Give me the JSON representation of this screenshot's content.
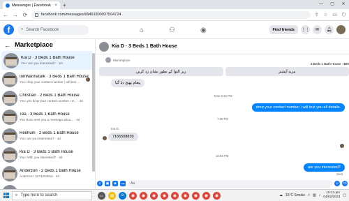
{
  "browser": {
    "tab_title": "Messenger | Facebook",
    "tab_close": "×",
    "new_tab": "+",
    "url": "facebook.com/messages/t/9491800937504724",
    "window_controls": [
      "—",
      "▢",
      "✕"
    ],
    "nav": {
      "back": "←",
      "forward": "→",
      "reload": "⟳"
    },
    "extensions": [
      "⇪",
      "☆",
      "▭",
      "⬡"
    ]
  },
  "fb_header": {
    "logo": "f",
    "search_placeholder": "Search Facebook",
    "find_friends": "Find friends",
    "nav_icons": [
      "home-icon",
      "groups-icon",
      "gaming-icon"
    ],
    "nav_glyphs": [
      "⌂",
      "⚇",
      "◉"
    ]
  },
  "sidebar": {
    "title": "Marketplace",
    "back_glyph": "←",
    "conversations": [
      {
        "name": "Kia D · 3 Beds 1 Bath House",
        "sub": "You: are you interested? · 1m",
        "active": true
      },
      {
        "name": "IonWannataIk · 3 Beds 1 Bath House",
        "sub": "You: drop your contact number i will text ...",
        "active": false
      },
      {
        "name": "Christian · 2 Beds 1 Bath House",
        "sub": "You: yes drop your contact number i w... · 4d",
        "active": false
      },
      {
        "name": "Tea · 3 Beds 1 Bath House",
        "sub": "Yea Ross sent you a message abou... · 4d",
        "active": false
      },
      {
        "name": "Reehum · 2 Beds 1 Bath House",
        "sub": "You: are you interested? · 4d",
        "active": false
      },
      {
        "name": "Kia D · 3 Beds 1 Bath House",
        "sub": "You: ARE you interested? · 4d",
        "active": false
      },
      {
        "name": "Anderzon · 2 Beds 1 Bath House",
        "sub": "Anderzon: 3474253916 · 4d",
        "active": false
      },
      {
        "name": "Beds 2 Baths House 3 · محمد",
        "sub": "",
        "active": false
      }
    ]
  },
  "chat": {
    "title": "Kia D · 3 Beds 1 Bath House",
    "marketplace_label": "Marketplace",
    "listing_line": "3 Beds 1 Bath House - $80",
    "action_buttons": [
      "مزید آپشنز",
      "زیر التوا کے بطور نشان زد کریں"
    ],
    "messages": {
      "urdu_prompt": "پیغام بھیج دیا گیا",
      "time1": "Mon 5:34 PM",
      "sent1": "drop your contact number i will text you all details.",
      "time2": "7:30 PM",
      "sender": "Kia D",
      "received_number": "7166508839",
      "time3": "10:53 PM",
      "sent2": "are you interested?",
      "sent_status": "Sent"
    },
    "composer": {
      "placeholder": "Aa",
      "icons": [
        "+",
        "▣",
        "◈",
        "GIF"
      ]
    }
  },
  "taskbar": {
    "search_placeholder": "Type here to search",
    "weather": "15°C  Smoke",
    "time": "10:13 pm",
    "date": "04/02/2023",
    "lang": "ENG"
  },
  "colors": {
    "fb_blue": "#1877f2",
    "messenger_blue": "#0084ff",
    "active_row": "#e7f3ff"
  }
}
